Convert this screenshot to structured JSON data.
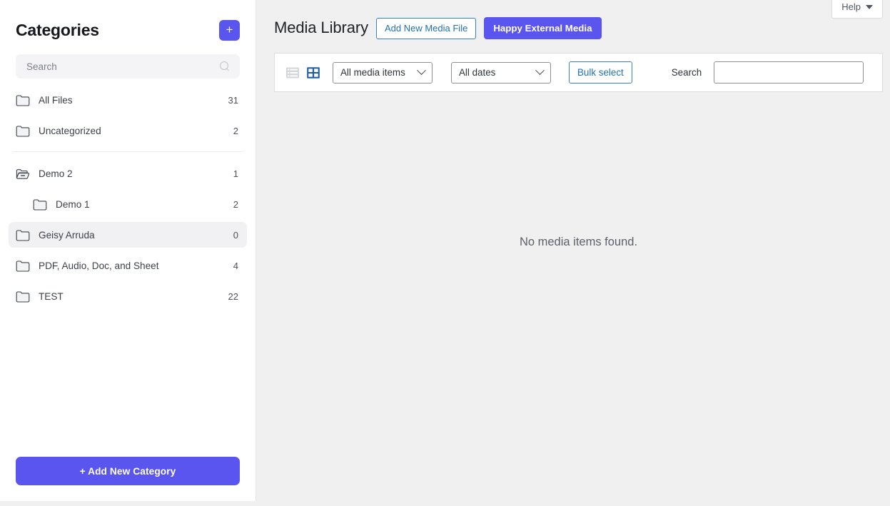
{
  "sidebar": {
    "title": "Categories",
    "add_button_label": "+",
    "search": {
      "value": "",
      "placeholder": "Search",
      "icon": "search-icon"
    },
    "items": [
      {
        "label": "All Files",
        "count": "31",
        "icon": "folder-icon",
        "level": 0,
        "selected": false
      },
      {
        "label": "Uncategorized",
        "count": "2",
        "icon": "folder-icon",
        "level": 0,
        "selected": false
      },
      {
        "label": "Demo 2",
        "count": "1",
        "icon": "folder-open-icon",
        "level": 0,
        "selected": false
      },
      {
        "label": "Demo 1",
        "count": "2",
        "icon": "folder-icon",
        "level": 1,
        "selected": false
      },
      {
        "label": "Geisy Arruda",
        "count": "0",
        "icon": "folder-icon",
        "level": 0,
        "selected": true
      },
      {
        "label": "PDF, Audio, Doc, and Sheet",
        "count": "4",
        "icon": "folder-icon",
        "level": 0,
        "selected": false
      },
      {
        "label": "TEST",
        "count": "22",
        "icon": "folder-icon",
        "level": 0,
        "selected": false
      }
    ],
    "add_new_category_label": "+ Add New Category"
  },
  "header": {
    "help_label": "Help",
    "help_icon": "chevron-down-icon",
    "page_title": "Media Library",
    "add_media_label": "Add New Media File",
    "external_media_label": "Happy External Media"
  },
  "toolbar": {
    "list_view_icon": "list-view-icon",
    "grid_view_icon": "grid-view-icon",
    "active_view": "grid",
    "media_type_value": "All media items",
    "dates_value": "All dates",
    "bulk_select_label": "Bulk select",
    "search_label": "Search",
    "search_value": "",
    "search_placeholder": ""
  },
  "content": {
    "empty_message": "No media items found."
  },
  "colors": {
    "accent_purple": "#5b55ef",
    "link_blue": "#2271b1",
    "border_blue": "#3582c4",
    "grid_icon_blue": "#1d5fa5",
    "page_bg": "#f0f0f1",
    "panel_bg": "#ffffff",
    "selected_row_bg": "#f1f1f3"
  }
}
